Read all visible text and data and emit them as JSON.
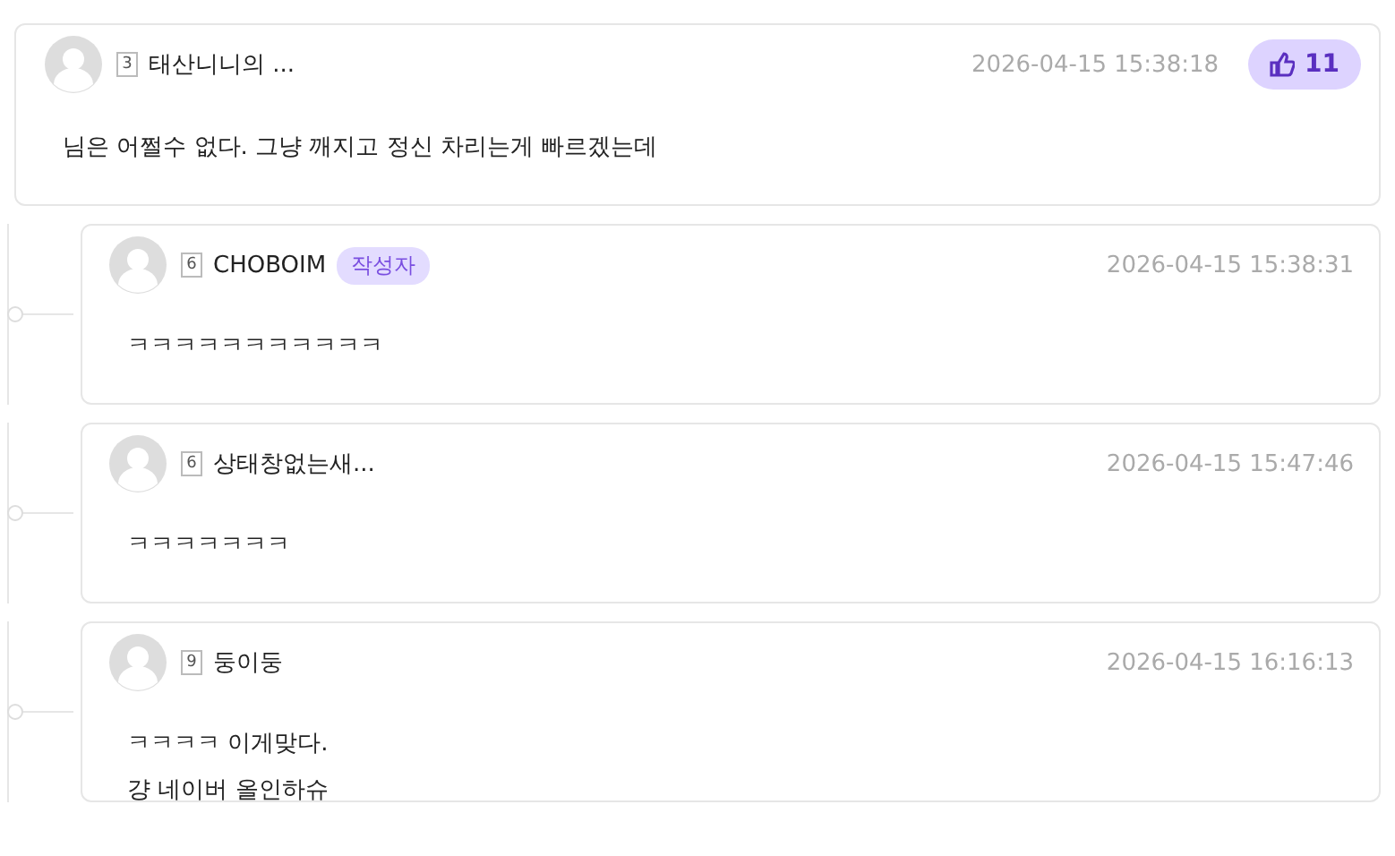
{
  "comment": {
    "level": "3",
    "author": "태산니니의 ...",
    "time": "2026-04-15 15:38:18",
    "likes": "11",
    "lines": [
      "님은 어쩔수 없다. 그냥 깨지고 정신 차리는게 빠르겠는데"
    ]
  },
  "replies": [
    {
      "level": "6",
      "author": "CHOBOIM",
      "badge": "작성자",
      "time": "2026-04-15 15:38:31",
      "lines": [
        "ㅋㅋㅋㅋㅋㅋㅋㅋㅋㅋㅋ"
      ]
    },
    {
      "level": "6",
      "author": "상태창없는새...",
      "time": "2026-04-15 15:47:46",
      "lines": [
        "ㅋㅋㅋㅋㅋㅋㅋ"
      ]
    },
    {
      "level": "9",
      "author": "둥이둥",
      "time": "2026-04-15 16:16:13",
      "lines": [
        "ㅋㅋㅋㅋ 이게맞다.",
        "걍 네이버 올인하슈"
      ]
    }
  ]
}
